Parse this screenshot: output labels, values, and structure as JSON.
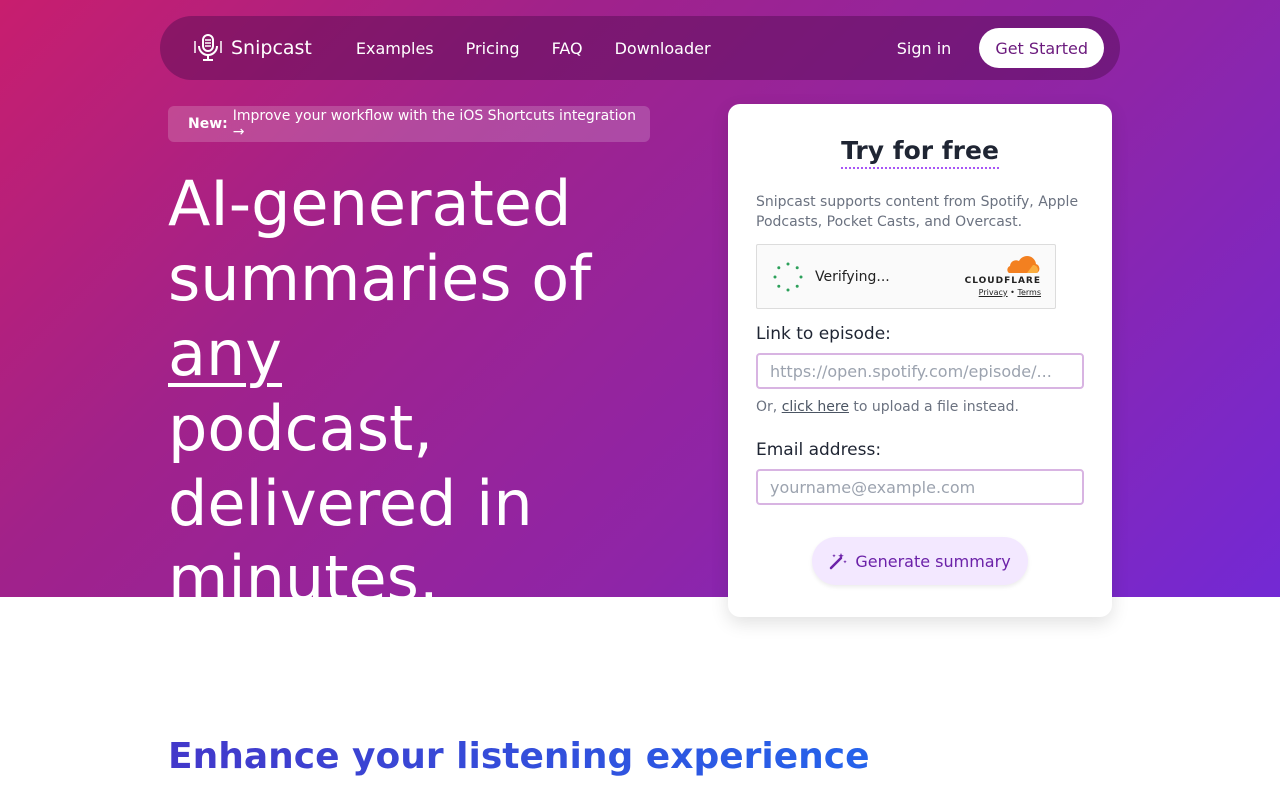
{
  "nav": {
    "brand": "Snipcast",
    "links": [
      "Examples",
      "Pricing",
      "FAQ",
      "Downloader"
    ],
    "sign_in": "Sign in",
    "get_started": "Get Started"
  },
  "announcement": {
    "badge": "New:",
    "text": "Improve your workflow with the iOS Shortcuts integration →"
  },
  "hero": {
    "line1": "AI-generated",
    "line2_pre": "summaries of ",
    "line2_emph": "any",
    "line3": "podcast,",
    "line4": "delivered in",
    "line5": "minutes."
  },
  "card": {
    "title": "Try for free",
    "support_text": "Snipcast supports content from Spotify, Apple Podcasts, Pocket Casts, and Overcast.",
    "captcha": {
      "status": "Verifying...",
      "provider": "CLOUDFLARE",
      "privacy": "Privacy",
      "separator": "•",
      "terms": "Terms"
    },
    "episode_label": "Link to episode:",
    "episode_placeholder": "https://open.spotify.com/episode/...",
    "upload_prefix": "Or,",
    "upload_link": "click here",
    "upload_suffix": "to upload a file instead.",
    "email_label": "Email address:",
    "email_placeholder": "yourname@example.com",
    "generate_button": "Generate summary"
  },
  "section": {
    "title": "Enhance your listening experience"
  },
  "colors": {
    "gradient_start": "#c81e6e",
    "gradient_end": "#7329d4",
    "button_text": "#6b21a8",
    "section_title": "#3b3f9e"
  }
}
